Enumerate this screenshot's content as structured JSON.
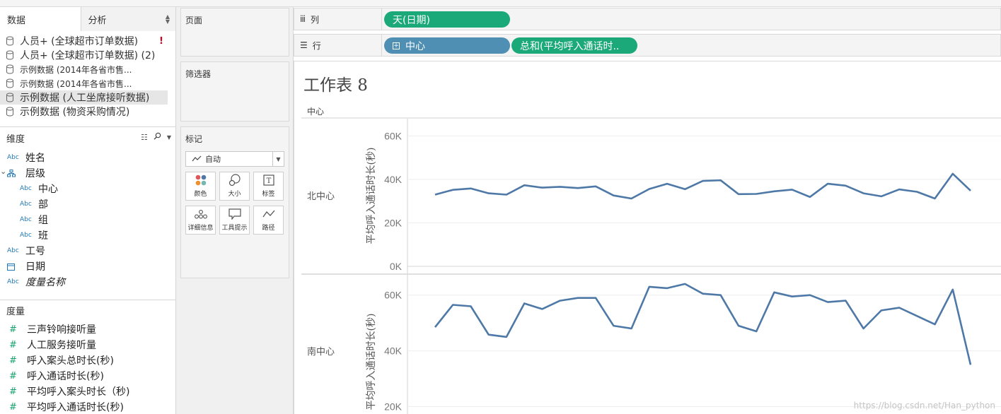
{
  "tabs": {
    "data": "数据",
    "analysis": "分析"
  },
  "datasources": [
    {
      "label": "人员+ (全球超市订单数据)",
      "size": "big",
      "warning": "!"
    },
    {
      "label": "人员+ (全球超市订单数据) (2)",
      "size": "big"
    },
    {
      "label": "示例数据 (2014年各省市售...",
      "size": "small"
    },
    {
      "label": "示例数据 (2014年各省市售...",
      "size": "small"
    },
    {
      "label": "示例数据 (人工坐席接听数据)",
      "size": "big",
      "selected": true
    },
    {
      "label": "示例数据 (物资采购情况)",
      "size": "big"
    }
  ],
  "dimensions": {
    "title": "维度",
    "items": [
      {
        "label": "姓名",
        "type": "Abc"
      },
      {
        "label": "层级",
        "type": "hierarchy"
      },
      {
        "label": "中心",
        "type": "Abc",
        "indent": true
      },
      {
        "label": "部",
        "type": "Abc",
        "indent": true
      },
      {
        "label": "组",
        "type": "Abc",
        "indent": true
      },
      {
        "label": "班",
        "type": "Abc",
        "indent": true
      },
      {
        "label": "工号",
        "type": "Abc"
      },
      {
        "label": "日期",
        "type": "date"
      },
      {
        "label": "度量名称",
        "type": "Abc",
        "italic": true
      }
    ]
  },
  "measures": {
    "title": "度量",
    "items": [
      "三声铃响接听量",
      "人工服务接听量",
      "呼入案头总时长(秒)",
      "呼入通话时长(秒)",
      "平均呼入案头时长（秒)",
      "平均呼入通话时长(秒)"
    ]
  },
  "cards": {
    "pages": "页面",
    "filters": "筛选器",
    "marks": "标记",
    "mark_type": "自动",
    "buttons": [
      "颜色",
      "大小",
      "标签",
      "详细信息",
      "工具提示",
      "路径"
    ]
  },
  "shelves": {
    "columns_label": "列",
    "rows_label": "行",
    "columns_pills": [
      "天(日期)"
    ],
    "rows_pills": [
      "中心",
      "总和(平均呼入通话时.."
    ]
  },
  "view": {
    "title": "工作表 8",
    "header_field": "中心",
    "watermark": "https://blog.csdn.net/Han_python"
  },
  "chart_data": [
    {
      "type": "line",
      "row": "北中心",
      "ylabel": "平均呼入通话时长(秒)",
      "ylim": [
        0,
        65000
      ],
      "yticks": [
        "0K",
        "20K",
        "40K",
        "60K"
      ],
      "ytick_values": [
        0,
        20000,
        40000,
        60000
      ],
      "grid": true,
      "color": "#4e79a7",
      "values": [
        33000,
        35200,
        35800,
        33600,
        33000,
        37300,
        36200,
        36600,
        36000,
        36800,
        32600,
        31200,
        35600,
        38000,
        35500,
        39300,
        39600,
        33200,
        33300,
        34500,
        35300,
        31900,
        38000,
        37100,
        33600,
        32200,
        35400,
        34300,
        31200,
        42600,
        34800
      ]
    },
    {
      "type": "line",
      "row": "南中心",
      "ylabel": "平均呼入通话时长(秒)",
      "ylim": [
        12000,
        65000
      ],
      "yticks": [
        "20K",
        "40K",
        "60K"
      ],
      "ytick_values": [
        20000,
        40000,
        60000
      ],
      "grid": true,
      "color": "#4e79a7",
      "values": [
        48500,
        56500,
        56000,
        45800,
        45000,
        57000,
        55000,
        58000,
        59000,
        59000,
        49000,
        48000,
        63000,
        62500,
        64000,
        60500,
        60000,
        49000,
        47000,
        61000,
        59500,
        60000,
        57500,
        58000,
        48000,
        54500,
        55500,
        52500,
        49500,
        62000,
        35000
      ]
    }
  ]
}
